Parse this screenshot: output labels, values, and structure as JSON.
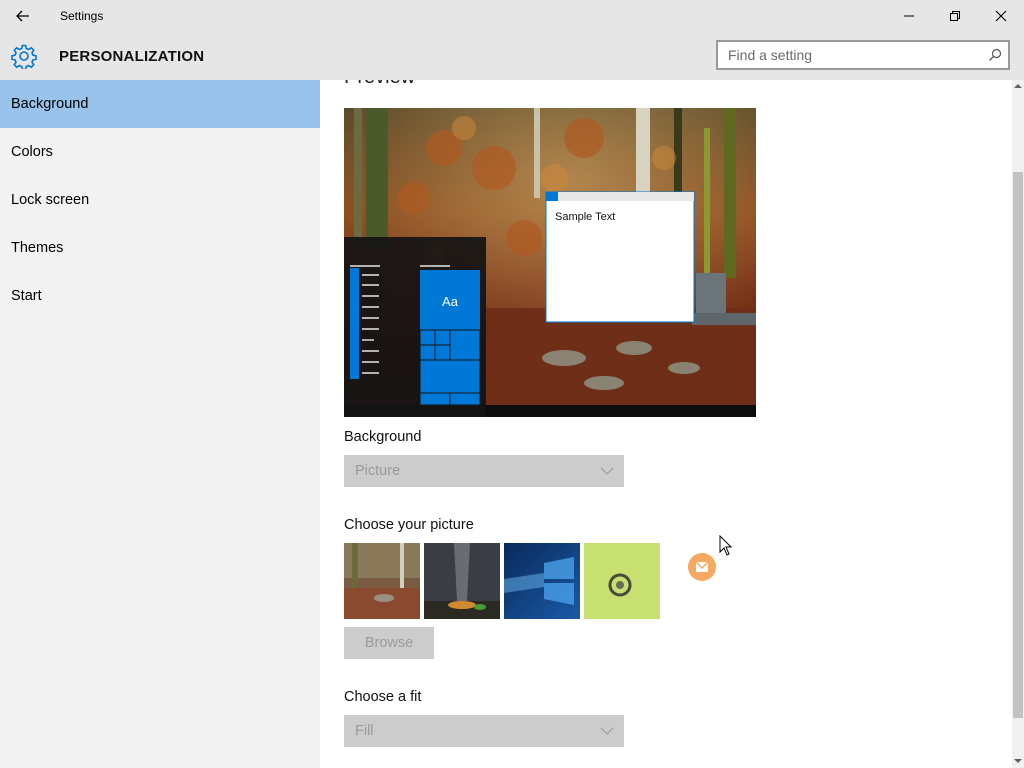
{
  "window": {
    "title": "Settings"
  },
  "header": {
    "title": "PERSONALIZATION",
    "search_placeholder": "Find a setting"
  },
  "sidebar": {
    "items": [
      {
        "label": "Background",
        "active": true
      },
      {
        "label": "Colors"
      },
      {
        "label": "Lock screen"
      },
      {
        "label": "Themes"
      },
      {
        "label": "Start"
      }
    ]
  },
  "main": {
    "preview_heading": "Preview",
    "preview": {
      "sample_text": "Sample Text",
      "tile_label": "Aa"
    },
    "background_label": "Background",
    "background_value": "Picture",
    "choose_picture_label": "Choose your picture",
    "browse_label": "Browse",
    "choose_fit_label": "Choose a fit",
    "fit_value": "Fill"
  },
  "colors": {
    "accent": "#0078d7",
    "selection": "#99c3ea",
    "sidebar_bg": "#f2f2f2",
    "titlebar_bg": "#e6e6e6"
  },
  "icons": [
    "back-arrow-icon",
    "minimize-icon",
    "maximize-icon",
    "close-icon",
    "gear-icon",
    "search-icon",
    "chevron-down-icon"
  ]
}
